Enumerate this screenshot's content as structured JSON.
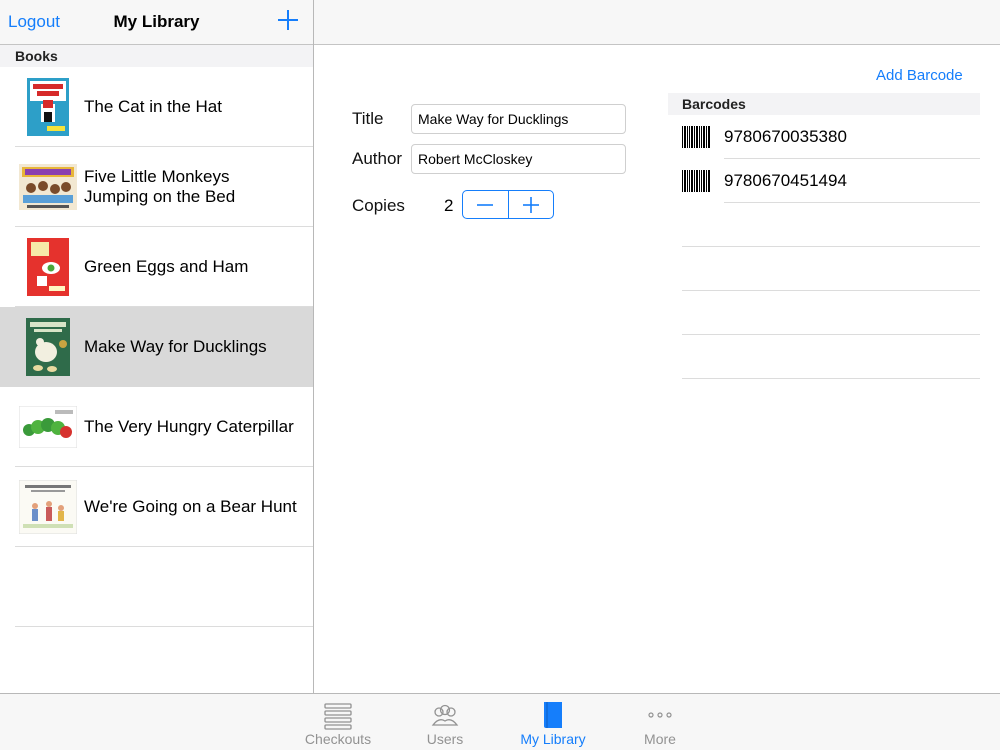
{
  "colors": {
    "accent": "#157efb",
    "selected_row": "#d9d9d9",
    "tab_inactive": "#929292"
  },
  "sidebar": {
    "nav": {
      "logout_label": "Logout",
      "title": "My Library",
      "add_icon": "plus-icon"
    },
    "section_header": "Books",
    "books": [
      {
        "title": "The Cat in the Hat",
        "cover_icon": "book-cover-cat-in-the-hat"
      },
      {
        "title": "Five Little Monkeys Jumping on the Bed",
        "cover_icon": "book-cover-five-little-monkeys"
      },
      {
        "title": "Green Eggs and Ham",
        "cover_icon": "book-cover-green-eggs-and-ham"
      },
      {
        "title": "Make Way for Ducklings",
        "cover_icon": "book-cover-make-way-for-ducklings",
        "selected": true
      },
      {
        "title": "The Very Hungry Caterpillar",
        "cover_icon": "book-cover-very-hungry-caterpillar"
      },
      {
        "title": "We're Going on a Bear Hunt",
        "cover_icon": "book-cover-bear-hunt"
      }
    ]
  },
  "detail": {
    "add_barcode_label": "Add Barcode",
    "title_label": "Title",
    "title_value": "Make Way for Ducklings",
    "author_label": "Author",
    "author_value": "Robert McCloskey",
    "copies_label": "Copies",
    "copies_value": "2",
    "stepper": {
      "minus_icon": "minus-icon",
      "plus_icon": "plus-icon"
    },
    "barcodes_header": "Barcodes",
    "barcodes": [
      {
        "value": "9780670035380",
        "icon": "barcode-icon"
      },
      {
        "value": "9780670451494",
        "icon": "barcode-icon"
      }
    ]
  },
  "tabbar": {
    "tabs": [
      {
        "label": "Checkouts",
        "icon": "list-icon",
        "active": false
      },
      {
        "label": "Users",
        "icon": "users-icon",
        "active": false
      },
      {
        "label": "My Library",
        "icon": "book-icon",
        "active": true
      },
      {
        "label": "More",
        "icon": "more-icon",
        "active": false
      }
    ]
  }
}
